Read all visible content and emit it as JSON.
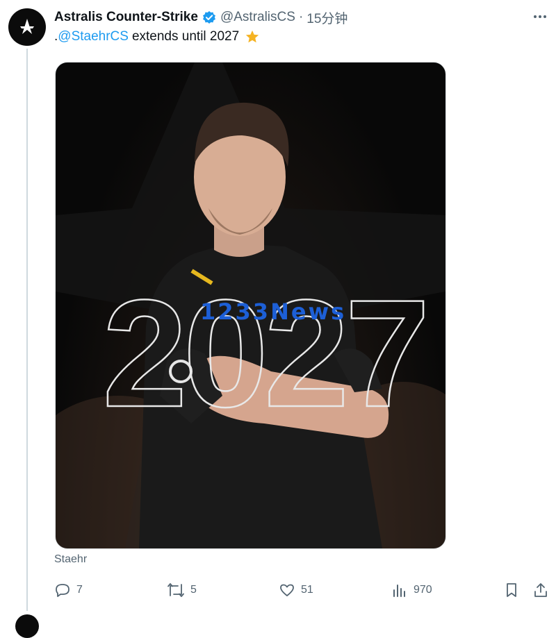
{
  "tweet": {
    "author_name": "Astralis Counter-Strike",
    "handle": "@AstralisCS",
    "separator": "·",
    "time": "15分钟",
    "text_prefix": ".",
    "mention": "@StaehrCS",
    "text_rest": "extends until 2027",
    "media_year": "2027",
    "watermark": "1233News",
    "caption": "Staehr"
  },
  "actions": {
    "replies": "7",
    "reposts": "5",
    "likes": "51",
    "views": "970"
  },
  "icons": [
    "astralis-logo-icon",
    "verified-badge-icon",
    "more-icon",
    "star-emoji-icon",
    "reply-icon",
    "repost-icon",
    "like-icon",
    "views-icon",
    "bookmark-icon",
    "share-icon"
  ],
  "colors": {
    "link": "#1d9bf0",
    "verified": "#1d9bf0",
    "star": "#f5b323",
    "muted": "#536471"
  }
}
